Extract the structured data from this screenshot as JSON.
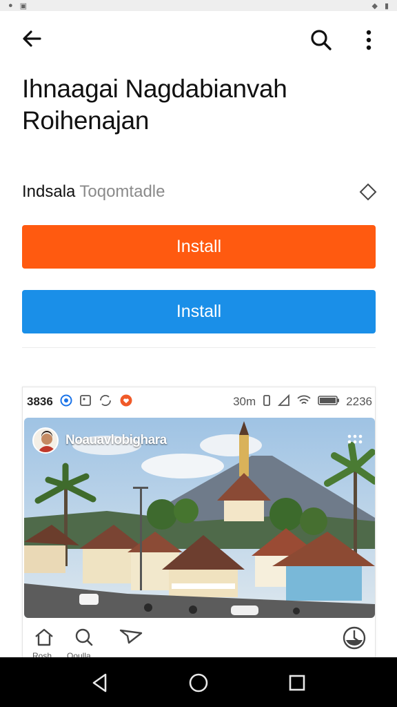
{
  "app_bar": {
    "back_icon": "arrow-left-icon",
    "search_icon": "search-icon",
    "more_icon": "more-vert-icon"
  },
  "app": {
    "title": "Ihnaagai Nagdabianvah Roihenajan",
    "developer": "Indsala",
    "developer_sub": "Toqomtadle",
    "wishlist_icon": "diamond-outline-icon"
  },
  "buttons": {
    "install_primary": "Install",
    "install_secondary": "Install",
    "primary_color": "#ff5a10",
    "secondary_color": "#1a8fe8"
  },
  "screenshot": {
    "status_time_left": "3836",
    "status_time_right": "2236",
    "status_size": "30m",
    "post_username": "Noauavlobighara",
    "nav_labels": [
      "Rosh",
      "Ooulla"
    ]
  }
}
